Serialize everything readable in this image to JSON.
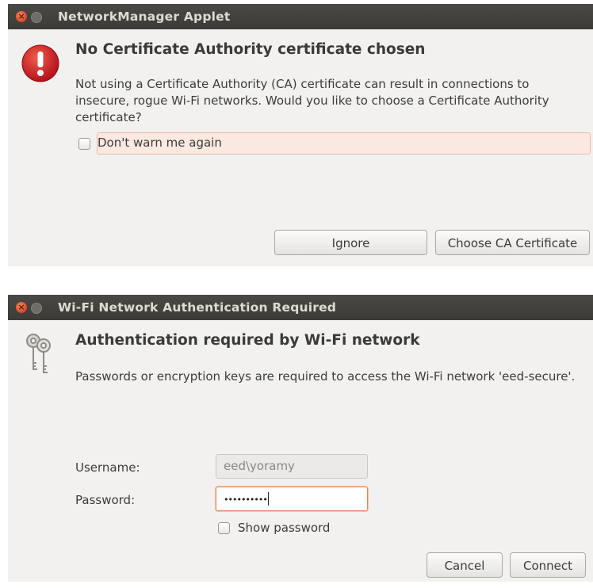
{
  "dialog1": {
    "window_title": "NetworkManager Applet",
    "heading": "No Certificate Authority certificate chosen",
    "message": "Not using a Certificate Authority (CA) certificate can result in connections to insecure, rogue Wi-Fi networks. Would you like to choose a Certificate Authority certificate?",
    "checkbox_label": "Don't warn me again",
    "checkbox_checked": false,
    "buttons": {
      "ignore": "Ignore",
      "choose": "Choose CA Certificate"
    }
  },
  "dialog2": {
    "window_title": "Wi-Fi Network Authentication Required",
    "heading": "Authentication required by Wi-Fi network",
    "message": "Passwords or encryption keys are required to access the Wi-Fi network 'eed-secure'.",
    "username_label": "Username:",
    "username_value": "eed\\yoramy",
    "password_label": "Password:",
    "password_value": "••••••••••",
    "show_password_label": "Show password",
    "show_password_checked": false,
    "buttons": {
      "cancel": "Cancel",
      "connect": "Connect"
    }
  },
  "icons": {
    "close": "close-icon",
    "minimize": "minimize-icon",
    "warning": "error-exclamation-icon",
    "keys": "keys-icon"
  },
  "colors": {
    "titlebar": "#3c3b37",
    "dialog_bg": "#f2f1f0",
    "warning_red": "#d01a1a",
    "focus_orange": "#e7845a",
    "highlight": "#fbe8e0"
  }
}
